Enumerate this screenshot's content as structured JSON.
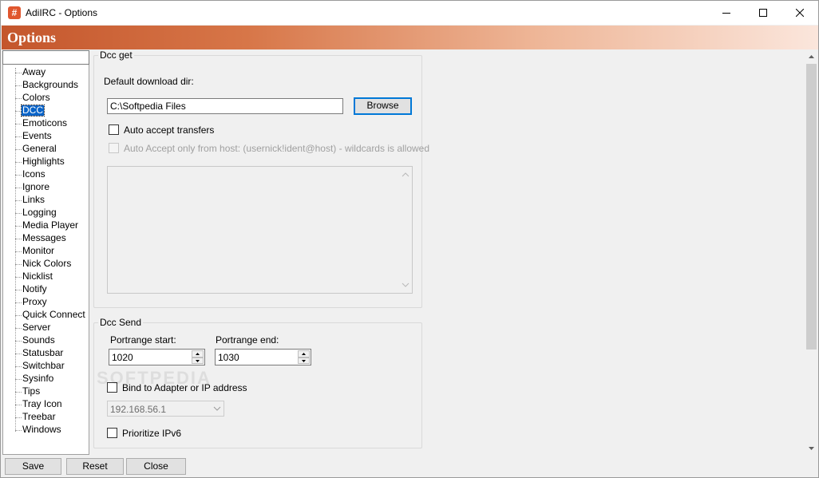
{
  "window": {
    "title": "AdiIRC - Options",
    "app_icon_glyph": "#",
    "accent_color": "#0078d7",
    "header_color": "#c4562c"
  },
  "header": {
    "title": "Options"
  },
  "tree": {
    "search_value": "",
    "selected": "DCC",
    "items": [
      "Away",
      "Backgrounds",
      "Colors",
      "DCC",
      "Emoticons",
      "Events",
      "General",
      "Highlights",
      "Icons",
      "Ignore",
      "Links",
      "Logging",
      "Media Player",
      "Messages",
      "Monitor",
      "Nick Colors",
      "Nicklist",
      "Notify",
      "Proxy",
      "Quick Connect",
      "Server",
      "Sounds",
      "Statusbar",
      "Switchbar",
      "Sysinfo",
      "Tips",
      "Tray Icon",
      "Treebar",
      "Windows"
    ]
  },
  "dcc_get": {
    "title": "Dcc get",
    "download_dir_label": "Default download dir:",
    "download_dir_value": "C:\\Softpedia Files",
    "browse_label": "Browse",
    "auto_accept_label": "Auto accept transfers",
    "auto_accept_checked": false,
    "auto_accept_host_label": "Auto Accept only from host: (usernick!ident@host) - wildcards is allowed",
    "auto_accept_host_checked": false
  },
  "dcc_send": {
    "title": "Dcc Send",
    "portrange_start_label": "Portrange start:",
    "portrange_start_value": "1020",
    "portrange_end_label": "Portrange end:",
    "portrange_end_value": "1030",
    "bind_label": "Bind to Adapter or IP address",
    "bind_checked": false,
    "ip_value": "192.168.56.1",
    "prioritize_ipv6_label": "Prioritize IPv6",
    "prioritize_ipv6_checked": false
  },
  "footer": {
    "save_label": "Save",
    "reset_label": "Reset",
    "close_label": "Close"
  },
  "watermark": "SOFTPEDIA"
}
